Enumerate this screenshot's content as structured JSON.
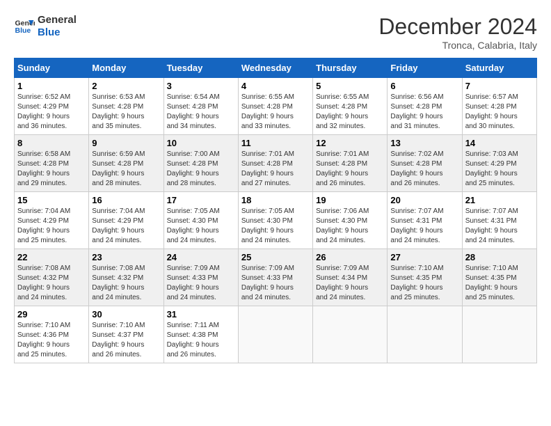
{
  "header": {
    "logo_line1": "General",
    "logo_line2": "Blue",
    "month_title": "December 2024",
    "subtitle": "Tronca, Calabria, Italy"
  },
  "days_of_week": [
    "Sunday",
    "Monday",
    "Tuesday",
    "Wednesday",
    "Thursday",
    "Friday",
    "Saturday"
  ],
  "weeks": [
    [
      {
        "day": "1",
        "info": "Sunrise: 6:52 AM\nSunset: 4:29 PM\nDaylight: 9 hours\nand 36 minutes."
      },
      {
        "day": "2",
        "info": "Sunrise: 6:53 AM\nSunset: 4:28 PM\nDaylight: 9 hours\nand 35 minutes."
      },
      {
        "day": "3",
        "info": "Sunrise: 6:54 AM\nSunset: 4:28 PM\nDaylight: 9 hours\nand 34 minutes."
      },
      {
        "day": "4",
        "info": "Sunrise: 6:55 AM\nSunset: 4:28 PM\nDaylight: 9 hours\nand 33 minutes."
      },
      {
        "day": "5",
        "info": "Sunrise: 6:55 AM\nSunset: 4:28 PM\nDaylight: 9 hours\nand 32 minutes."
      },
      {
        "day": "6",
        "info": "Sunrise: 6:56 AM\nSunset: 4:28 PM\nDaylight: 9 hours\nand 31 minutes."
      },
      {
        "day": "7",
        "info": "Sunrise: 6:57 AM\nSunset: 4:28 PM\nDaylight: 9 hours\nand 30 minutes."
      }
    ],
    [
      {
        "day": "8",
        "info": "Sunrise: 6:58 AM\nSunset: 4:28 PM\nDaylight: 9 hours\nand 29 minutes."
      },
      {
        "day": "9",
        "info": "Sunrise: 6:59 AM\nSunset: 4:28 PM\nDaylight: 9 hours\nand 28 minutes."
      },
      {
        "day": "10",
        "info": "Sunrise: 7:00 AM\nSunset: 4:28 PM\nDaylight: 9 hours\nand 28 minutes."
      },
      {
        "day": "11",
        "info": "Sunrise: 7:01 AM\nSunset: 4:28 PM\nDaylight: 9 hours\nand 27 minutes."
      },
      {
        "day": "12",
        "info": "Sunrise: 7:01 AM\nSunset: 4:28 PM\nDaylight: 9 hours\nand 26 minutes."
      },
      {
        "day": "13",
        "info": "Sunrise: 7:02 AM\nSunset: 4:28 PM\nDaylight: 9 hours\nand 26 minutes."
      },
      {
        "day": "14",
        "info": "Sunrise: 7:03 AM\nSunset: 4:29 PM\nDaylight: 9 hours\nand 25 minutes."
      }
    ],
    [
      {
        "day": "15",
        "info": "Sunrise: 7:04 AM\nSunset: 4:29 PM\nDaylight: 9 hours\nand 25 minutes."
      },
      {
        "day": "16",
        "info": "Sunrise: 7:04 AM\nSunset: 4:29 PM\nDaylight: 9 hours\nand 24 minutes."
      },
      {
        "day": "17",
        "info": "Sunrise: 7:05 AM\nSunset: 4:30 PM\nDaylight: 9 hours\nand 24 minutes."
      },
      {
        "day": "18",
        "info": "Sunrise: 7:05 AM\nSunset: 4:30 PM\nDaylight: 9 hours\nand 24 minutes."
      },
      {
        "day": "19",
        "info": "Sunrise: 7:06 AM\nSunset: 4:30 PM\nDaylight: 9 hours\nand 24 minutes."
      },
      {
        "day": "20",
        "info": "Sunrise: 7:07 AM\nSunset: 4:31 PM\nDaylight: 9 hours\nand 24 minutes."
      },
      {
        "day": "21",
        "info": "Sunrise: 7:07 AM\nSunset: 4:31 PM\nDaylight: 9 hours\nand 24 minutes."
      }
    ],
    [
      {
        "day": "22",
        "info": "Sunrise: 7:08 AM\nSunset: 4:32 PM\nDaylight: 9 hours\nand 24 minutes."
      },
      {
        "day": "23",
        "info": "Sunrise: 7:08 AM\nSunset: 4:32 PM\nDaylight: 9 hours\nand 24 minutes."
      },
      {
        "day": "24",
        "info": "Sunrise: 7:09 AM\nSunset: 4:33 PM\nDaylight: 9 hours\nand 24 minutes."
      },
      {
        "day": "25",
        "info": "Sunrise: 7:09 AM\nSunset: 4:33 PM\nDaylight: 9 hours\nand 24 minutes."
      },
      {
        "day": "26",
        "info": "Sunrise: 7:09 AM\nSunset: 4:34 PM\nDaylight: 9 hours\nand 24 minutes."
      },
      {
        "day": "27",
        "info": "Sunrise: 7:10 AM\nSunset: 4:35 PM\nDaylight: 9 hours\nand 25 minutes."
      },
      {
        "day": "28",
        "info": "Sunrise: 7:10 AM\nSunset: 4:35 PM\nDaylight: 9 hours\nand 25 minutes."
      }
    ],
    [
      {
        "day": "29",
        "info": "Sunrise: 7:10 AM\nSunset: 4:36 PM\nDaylight: 9 hours\nand 25 minutes."
      },
      {
        "day": "30",
        "info": "Sunrise: 7:10 AM\nSunset: 4:37 PM\nDaylight: 9 hours\nand 26 minutes."
      },
      {
        "day": "31",
        "info": "Sunrise: 7:11 AM\nSunset: 4:38 PM\nDaylight: 9 hours\nand 26 minutes."
      },
      {
        "day": "",
        "info": ""
      },
      {
        "day": "",
        "info": ""
      },
      {
        "day": "",
        "info": ""
      },
      {
        "day": "",
        "info": ""
      }
    ]
  ]
}
